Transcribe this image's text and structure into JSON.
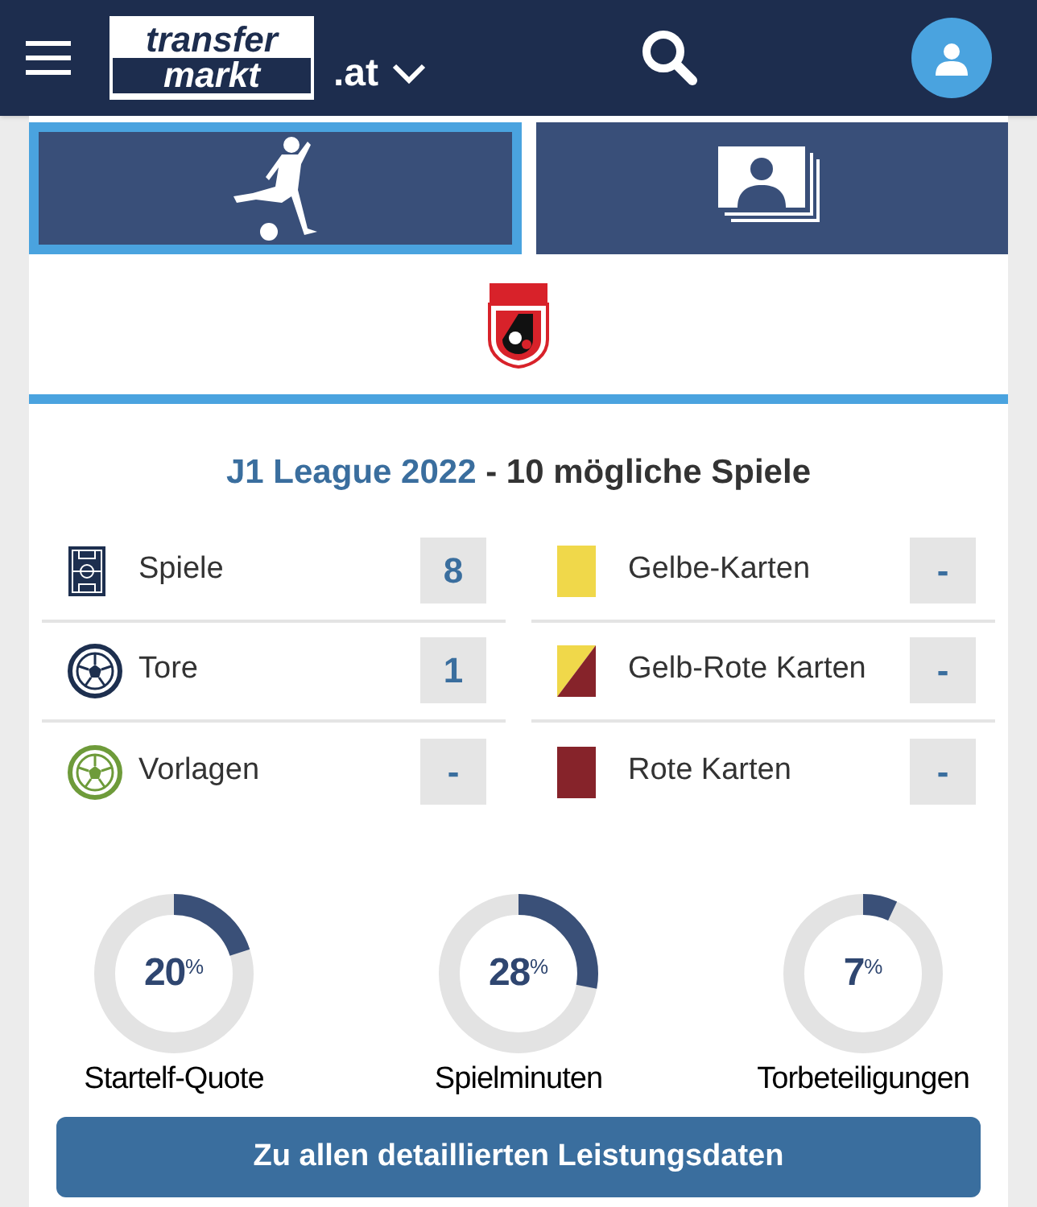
{
  "header": {
    "logo_top": "transfer",
    "logo_bottom": "markt",
    "domain": ".at"
  },
  "tabs": [
    {
      "kind": "player",
      "selected": true
    },
    {
      "kind": "photos",
      "selected": false
    }
  ],
  "competition": {
    "name": "J1 League 2022",
    "separator": " - ",
    "games": "10 mögliche Spiele"
  },
  "stats_left": [
    {
      "kind": "pitch",
      "label": "Spiele",
      "value": "8"
    },
    {
      "kind": "goal",
      "label": "Tore",
      "value": "1"
    },
    {
      "kind": "assist",
      "label": "Vorlagen",
      "value": "-"
    }
  ],
  "stats_right": [
    {
      "kind": "yellow",
      "label": "Gelbe-Karten",
      "value": "-"
    },
    {
      "kind": "yellow-red",
      "label": "Gelb-Rote Karten",
      "value": "-"
    },
    {
      "kind": "red",
      "label": "Rote Karten",
      "value": "-"
    }
  ],
  "gauges": [
    {
      "value": "20",
      "unit": "%",
      "label": "Startelf-Quote"
    },
    {
      "value": "28",
      "unit": "%",
      "label": "Spielminuten"
    },
    {
      "value": "7",
      "unit": "%",
      "label": "Torbeteiligungen"
    }
  ],
  "button": "Zu allen detaillierten Leistungsdaten"
}
